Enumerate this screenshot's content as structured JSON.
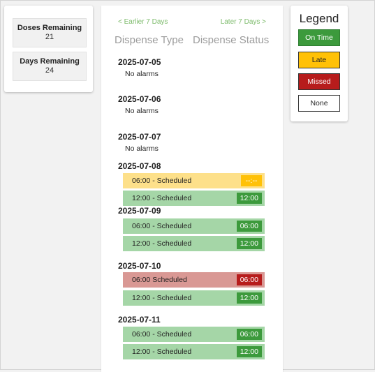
{
  "stats": {
    "doses_label": "Doses Remaining",
    "doses_value": "21",
    "days_label": "Days Remaining",
    "days_value": "24"
  },
  "nav": {
    "prev_label": "< Earlier 7 Days",
    "next_label": "Later 7 Days >"
  },
  "headers": {
    "type": "Dispense Type",
    "status": "Dispense Status"
  },
  "days": [
    {
      "date": "2025-07-05",
      "no_alarms": "No alarms"
    },
    {
      "date": "2025-07-06",
      "no_alarms": "No alarms"
    },
    {
      "date": "2025-07-07",
      "no_alarms": "No alarms"
    },
    {
      "date": "2025-07-08",
      "rows": [
        {
          "label": "06:00 - Scheduled",
          "status": "--:--",
          "state": "late"
        },
        {
          "label": "12:00 - Scheduled",
          "status": "12:00",
          "state": "ontime"
        }
      ]
    },
    {
      "date": "2025-07-09",
      "rows": [
        {
          "label": "06:00 - Scheduled",
          "status": "06:00",
          "state": "ontime"
        },
        {
          "label": "12:00 - Scheduled",
          "status": "12:00",
          "state": "ontime"
        }
      ]
    },
    {
      "date": "2025-07-10",
      "rows": [
        {
          "label": "06:00  Scheduled",
          "status": "06:00",
          "state": "missed"
        },
        {
          "label": "12:00 - Scheduled",
          "status": "12:00",
          "state": "ontime"
        }
      ]
    },
    {
      "date": "2025-07-11",
      "rows": [
        {
          "label": "06:00 - Scheduled",
          "status": "06:00",
          "state": "ontime"
        },
        {
          "label": "12:00 - Scheduled",
          "status": "12:00",
          "state": "ontime"
        }
      ]
    }
  ],
  "legend": {
    "title": "Legend",
    "on_time": "On Time",
    "late": "Late",
    "missed": "Missed",
    "none": "None"
  },
  "colors": {
    "on_time": "#3c9a3c",
    "late": "#ffc107",
    "missed": "#b71c1c",
    "link": "#7dbb6b"
  }
}
